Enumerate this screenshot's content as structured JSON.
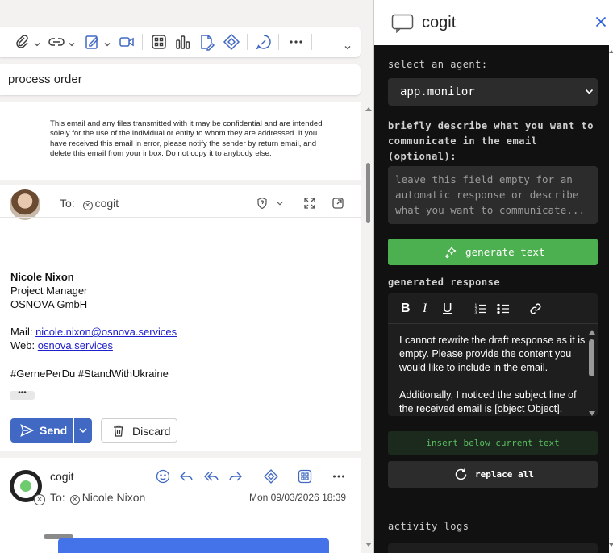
{
  "compose": {
    "subject": "process order",
    "disclaimer": "This email and any files transmitted with it may be confidential and are intended solely for the use of the individual or entity to whom they are addressed. If you have received this email in error, please notify the sender by return email, and delete this email from your inbox. Do not copy it to anybody else.",
    "to_label": "To:",
    "to_recipient": "cogit",
    "signature": {
      "name": "Nicole Nixon",
      "role": "Project Manager",
      "company": "OSNOVA GmbH",
      "mail_label": "Mail:",
      "mail": "nicole.nixon@osnova.services",
      "web_label": "Web:",
      "web": "osnova.services",
      "tags": "#GernePerDu #StandWithUkraine"
    },
    "dots": "•••",
    "send_label": "Send",
    "discard_label": "Discard"
  },
  "received": {
    "sender": "cogit",
    "to_label": "To:",
    "to_recipient": "Nicole Nixon",
    "date": "Mon 09/03/2026 18:39"
  },
  "panel": {
    "title": "cogit",
    "select_agent_label": "select an agent:",
    "agent_value": "app.monitor",
    "describe_label": "briefly describe what you want to communicate in the email (optional):",
    "describe_placeholder": "leave this field empty for an automatic response or describe what you want to communicate...",
    "generate_label": "generate text",
    "generated_label": "generated response",
    "generated_text_1": "I cannot rewrite the draft response as it is empty. Please provide the content you would like to include in the email.",
    "generated_text_2": "Additionally, I noticed the subject line of the received email is [object Object].",
    "insert_label": "insert below current text",
    "replace_label": "replace all",
    "activity_label": "activity logs"
  },
  "colors": {
    "accent_blue": "#4169c4",
    "generate_green": "#4caf50",
    "panel_bg": "#111111"
  }
}
